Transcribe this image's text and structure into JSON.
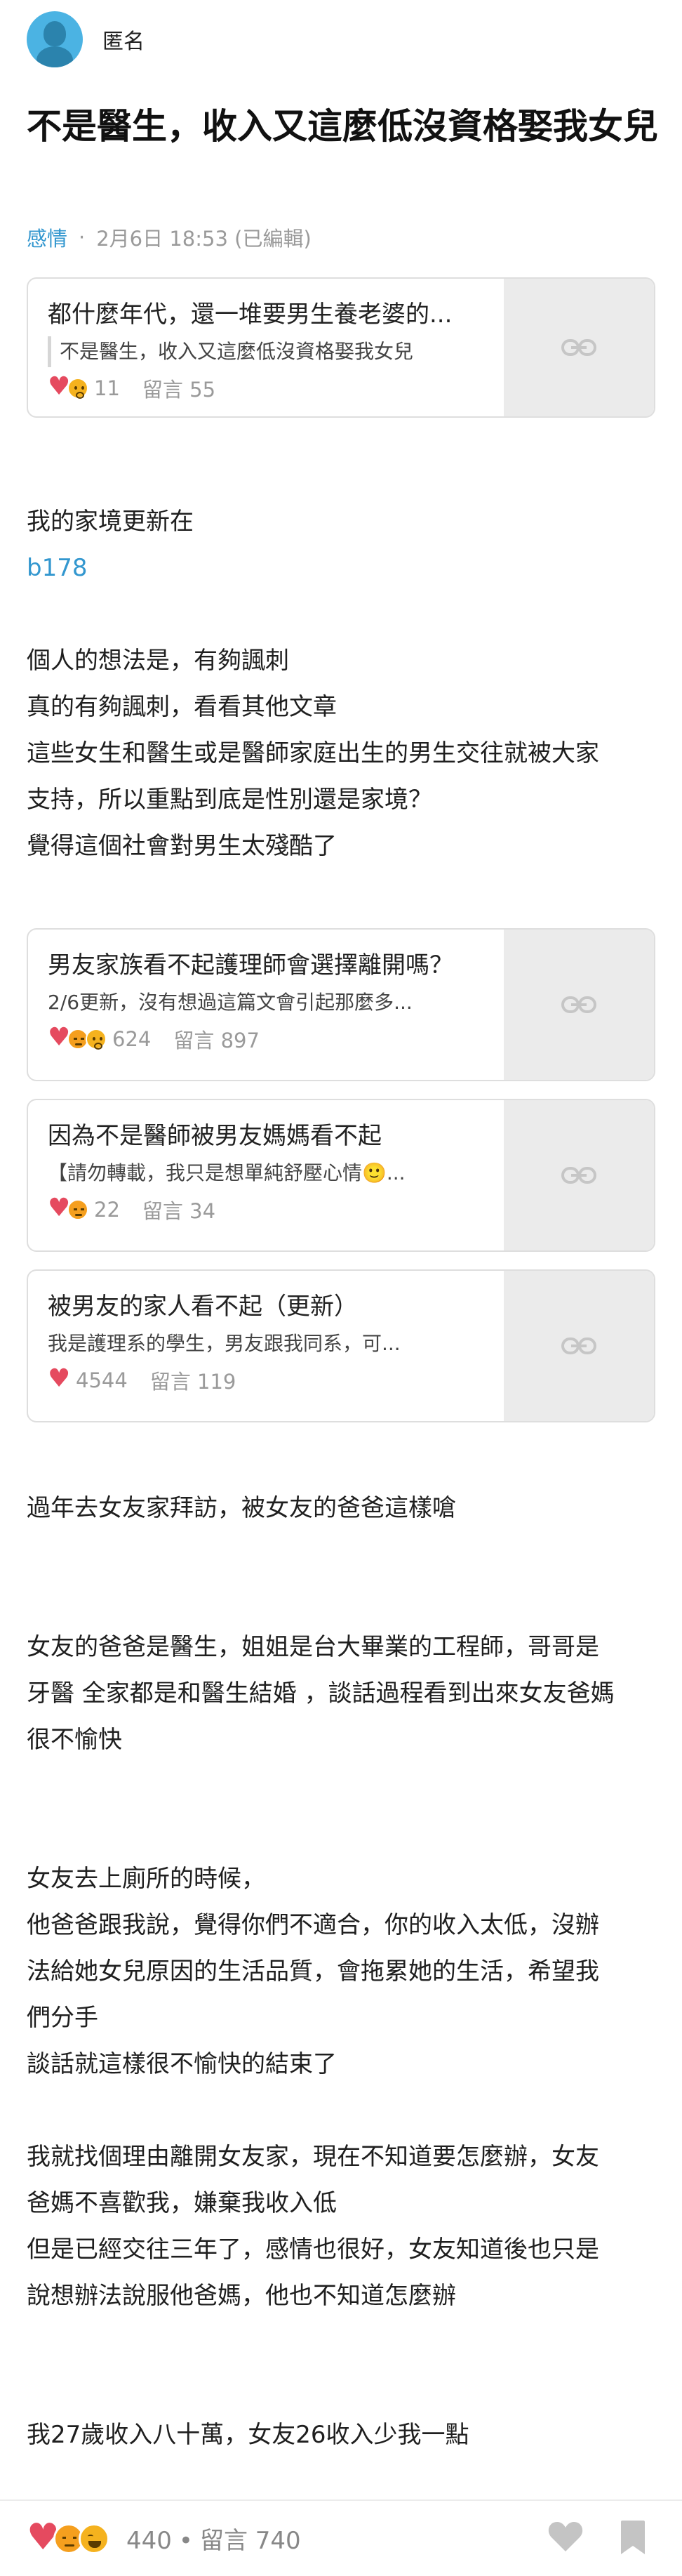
{
  "author": "匿名",
  "title": "不是醫生，收入又這麼低沒資格娶我女兒",
  "meta": {
    "board": "感情",
    "separator": "·",
    "time": "2月6日 18:53 (已編輯)"
  },
  "cards": [
    {
      "title": "都什麼年代，還一堆要男生養老婆的...",
      "excerpt": "不是醫生，收入又這麼低沒資格娶我女兒",
      "reactions": [
        "heart",
        "face"
      ],
      "likes": "11",
      "comments": "留言 55"
    },
    {
      "title": "男友家族看不起護理師會選擇離開嗎？",
      "excerpt": "2/6更新，沒有想過這篇文會引起那麼多...",
      "reactions": [
        "heart",
        "angry",
        "face"
      ],
      "likes": "624",
      "comments": "留言 897"
    },
    {
      "title": "因為不是醫師被男友媽媽看不起",
      "excerpt": "【請勿轉載，我只是想單純舒壓心情🙂...",
      "reactions": [
        "heart",
        "angry"
      ],
      "likes": "22",
      "comments": "留言 34"
    },
    {
      "title": "被男友的家人看不起（更新）",
      "excerpt": "我是護理系的學生，男友跟我同系，可...",
      "reactions": [
        "heart"
      ],
      "likes": "4544",
      "comments": "留言 119"
    }
  ],
  "body": {
    "p1": "我的家境更新在",
    "p1_link": "b178",
    "p2": "個人的想法是，有夠諷刺",
    "p3": "真的有夠諷刺，看看其他文章",
    "p4a": "這些女生和醫生或是醫師家庭出生的男生交往就被大家",
    "p4b": "支持，所以重點到底是性別還是家境？",
    "p5": "覺得這個社會對男生太殘酷了",
    "p6": "過年去女友家拜訪，被女友的爸爸這樣嗆",
    "p7a": "女友的爸爸是醫生，姐姐是台大畢業的工程師，哥哥是",
    "p7b": "牙醫 全家都是和醫生結婚 ，談話過程看到出來女友爸媽",
    "p7c": "很不愉快",
    "p8": "女友去上廁所的時候，",
    "p9a": "他爸爸跟我說，覺得你們不適合，你的收入太低，沒辦",
    "p9b": "法給她女兒原因的生活品質，會拖累她的生活，希望我",
    "p9c": "們分手",
    "p10": "談話就這樣很不愉快的結束了",
    "p11a": "我就找個理由離開女友家，現在不知道要怎麼辦，女友",
    "p11b": "爸媽不喜歡我，嫌棄我收入低",
    "p12a": "但是已經交往三年了，感情也很好，女友知道後也只是",
    "p12b": "說想辦法說服他爸媽，他也不知道怎麼辦",
    "p13": "我27歲收入八十萬，女友26收入少我一點"
  },
  "footer": {
    "reactions": [
      "heart",
      "angry",
      "laugh"
    ],
    "likes": "440",
    "separator": "•",
    "comments": "留言 740"
  },
  "icons": {
    "link": "link-icon",
    "like": "heart-outline-icon",
    "bookmark": "bookmark-icon"
  },
  "colors": {
    "accent": "#3397cf",
    "heart": "#e54a5f",
    "card_side": "#ebebeb"
  }
}
